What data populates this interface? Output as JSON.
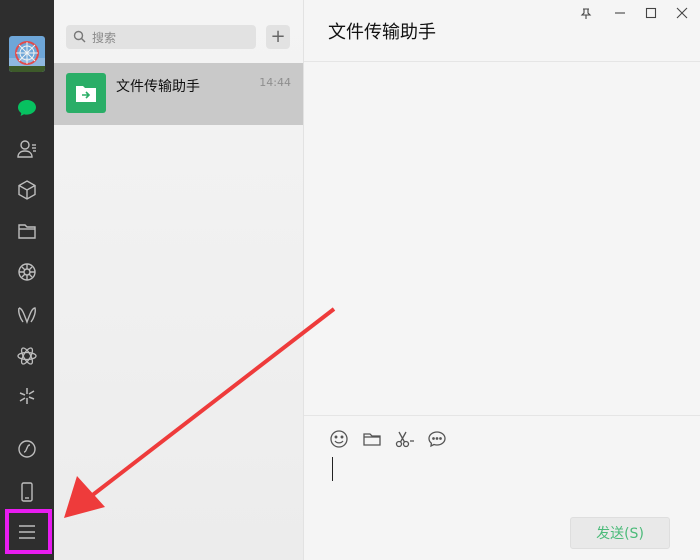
{
  "sidebar": {
    "items": [
      {
        "name": "chat-icon",
        "active": true
      },
      {
        "name": "contacts-icon"
      },
      {
        "name": "favorites-icon"
      },
      {
        "name": "files-icon"
      },
      {
        "name": "moments-icon"
      },
      {
        "name": "channels-icon"
      },
      {
        "name": "mini-programs-icon"
      },
      {
        "name": "search-discover-icon"
      },
      {
        "name": "mini-program-panel-icon"
      },
      {
        "name": "phone-icon"
      },
      {
        "name": "menu-icon"
      }
    ],
    "accent_color": "#07c160",
    "highlight_color": "#e81cf0"
  },
  "search": {
    "placeholder": "搜索"
  },
  "chat_list": [
    {
      "name": "文件传输助手",
      "time": "14:44"
    }
  ],
  "chat": {
    "title": "文件传输助手"
  },
  "composer": {
    "tools": [
      "emoji-icon",
      "folder-icon",
      "scissors-icon",
      "chat-history-icon"
    ],
    "send_label": "发送(S)"
  },
  "annotation": {
    "arrow_color": "#ee3b3b"
  }
}
